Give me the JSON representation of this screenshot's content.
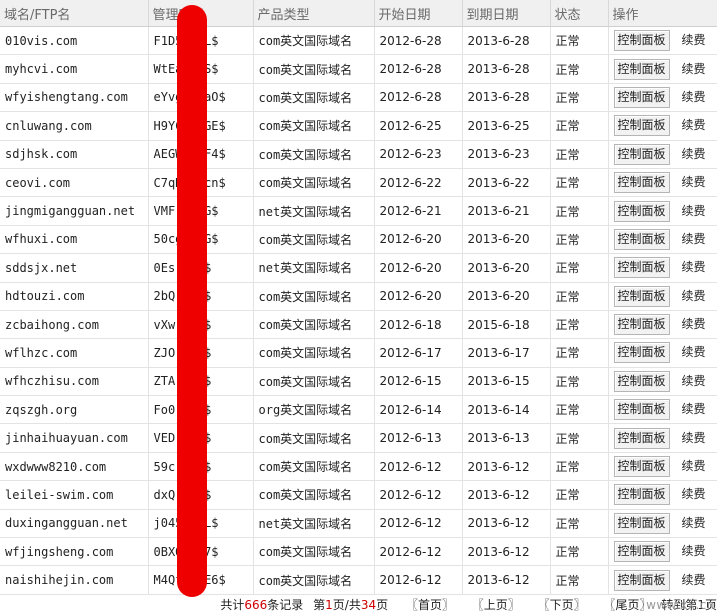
{
  "columns": [
    "域名/FTP名",
    "管理密码",
    "产品类型",
    "开始日期",
    "到期日期",
    "状态",
    "操作"
  ],
  "row_actions": {
    "panel": "控制面板",
    "renew": "续费"
  },
  "rows": [
    {
      "domain": "010vis.com",
      "password": "F1D5 MkL$",
      "type": "com英文国际域名",
      "start": "2012-6-28",
      "end": "2013-6-28",
      "status": "正常"
    },
    {
      "domain": "myhcvi.com",
      "password": "WtEa WWS$",
      "type": "com英文国际域名",
      "start": "2012-6-28",
      "end": "2013-6-28",
      "status": "正常"
    },
    {
      "domain": "wfyishengtang.com",
      "password": "eYvg HYaO$",
      "type": "com英文国际域名",
      "start": "2012-6-28",
      "end": "2013-6-28",
      "status": "正常"
    },
    {
      "domain": "cnluwang.com",
      "password": "H9YC MdGE$",
      "type": "com英文国际域名",
      "start": "2012-6-25",
      "end": "2013-6-25",
      "status": "正常"
    },
    {
      "domain": "sdjhsk.com",
      "password": "AEGW 3IF4$",
      "type": "com英文国际域名",
      "start": "2012-6-23",
      "end": "2013-6-23",
      "status": "正常"
    },
    {
      "domain": "ceovi.com",
      "password": "C7qD Phcn$",
      "type": "com英文国际域名",
      "start": "2012-6-22",
      "end": "2013-6-22",
      "status": "正常"
    },
    {
      "domain": "jingmigangguan.net",
      "password": "VMFr wGG$",
      "type": "net英文国际域名",
      "start": "2012-6-21",
      "end": "2013-6-21",
      "status": "正常"
    },
    {
      "domain": "wfhuxi.com",
      "password": "50cg OsG$",
      "type": "com英文国际域名",
      "start": "2012-6-20",
      "end": "2013-6-20",
      "status": "正常"
    },
    {
      "domain": "sddsjx.net",
      "password": "0Es 7jc$",
      "type": "net英文国际域名",
      "start": "2012-6-20",
      "end": "2013-6-20",
      "status": "正常"
    },
    {
      "domain": "hdtouzi.com",
      "password": "2bQ ZQ1$",
      "type": "com英文国际域名",
      "start": "2012-6-20",
      "end": "2013-6-20",
      "status": "正常"
    },
    {
      "domain": "zcbaihong.com",
      "password": "vXw V3Q$",
      "type": "com英文国际域名",
      "start": "2012-6-18",
      "end": "2015-6-18",
      "status": "正常"
    },
    {
      "domain": "wflhzc.com",
      "password": "ZJO S6a$",
      "type": "com英文国际域名",
      "start": "2012-6-17",
      "end": "2013-6-17",
      "status": "正常"
    },
    {
      "domain": "wfhczhisu.com",
      "password": "ZTA aQ2$",
      "type": "com英文国际域名",
      "start": "2012-6-15",
      "end": "2013-6-15",
      "status": "正常"
    },
    {
      "domain": "zqszgh.org",
      "password": "Fo0 DEO$",
      "type": "org英文国际域名",
      "start": "2012-6-14",
      "end": "2013-6-14",
      "status": "正常"
    },
    {
      "domain": "jinhaihuayuan.com",
      "password": "VED Fn6$",
      "type": "com英文国际域名",
      "start": "2012-6-13",
      "end": "2013-6-13",
      "status": "正常"
    },
    {
      "domain": "wxdwww8210.com",
      "password": "59c 2d0$",
      "type": "com英文国际域名",
      "start": "2012-6-12",
      "end": "2013-6-12",
      "status": "正常"
    },
    {
      "domain": "leilei-swim.com",
      "password": "dxQ iZy$",
      "type": "com英文国际域名",
      "start": "2012-6-12",
      "end": "2013-6-12",
      "status": "正常"
    },
    {
      "domain": "duxingangguan.net",
      "password": "j045 j8L$",
      "type": "net英文国际域名",
      "start": "2012-6-12",
      "end": "2013-6-12",
      "status": "正常"
    },
    {
      "domain": "wfjingsheng.com",
      "password": "0BXO Fb7$",
      "type": "com英文国际域名",
      "start": "2012-6-12",
      "end": "2013-6-12",
      "status": "正常"
    },
    {
      "domain": "naishihejin.com",
      "password": "M4Qf 31E6$",
      "type": "com英文国际域名",
      "start": "2012-6-12",
      "end": "2013-6-12",
      "status": "正常"
    }
  ],
  "pager": {
    "total_prefix": "共计",
    "total_count": "666",
    "total_suffix": "条记录",
    "page_prefix": "第",
    "current_page": "1",
    "page_mid": "页/共",
    "total_pages": "34",
    "page_suffix": "页",
    "first": "〖首页〗",
    "prev": "〖上页〗",
    "next": "〖下页〗",
    "last": "〖尾页〗",
    "goto_prefix": "转到第",
    "goto_value": "1",
    "goto_suffix": "页"
  },
  "watermark": "www.xx.cn",
  "colors": {
    "redaction": "#ee0000",
    "header_bg": "#f0f0f0",
    "pager_emphasis": "#d00000"
  }
}
